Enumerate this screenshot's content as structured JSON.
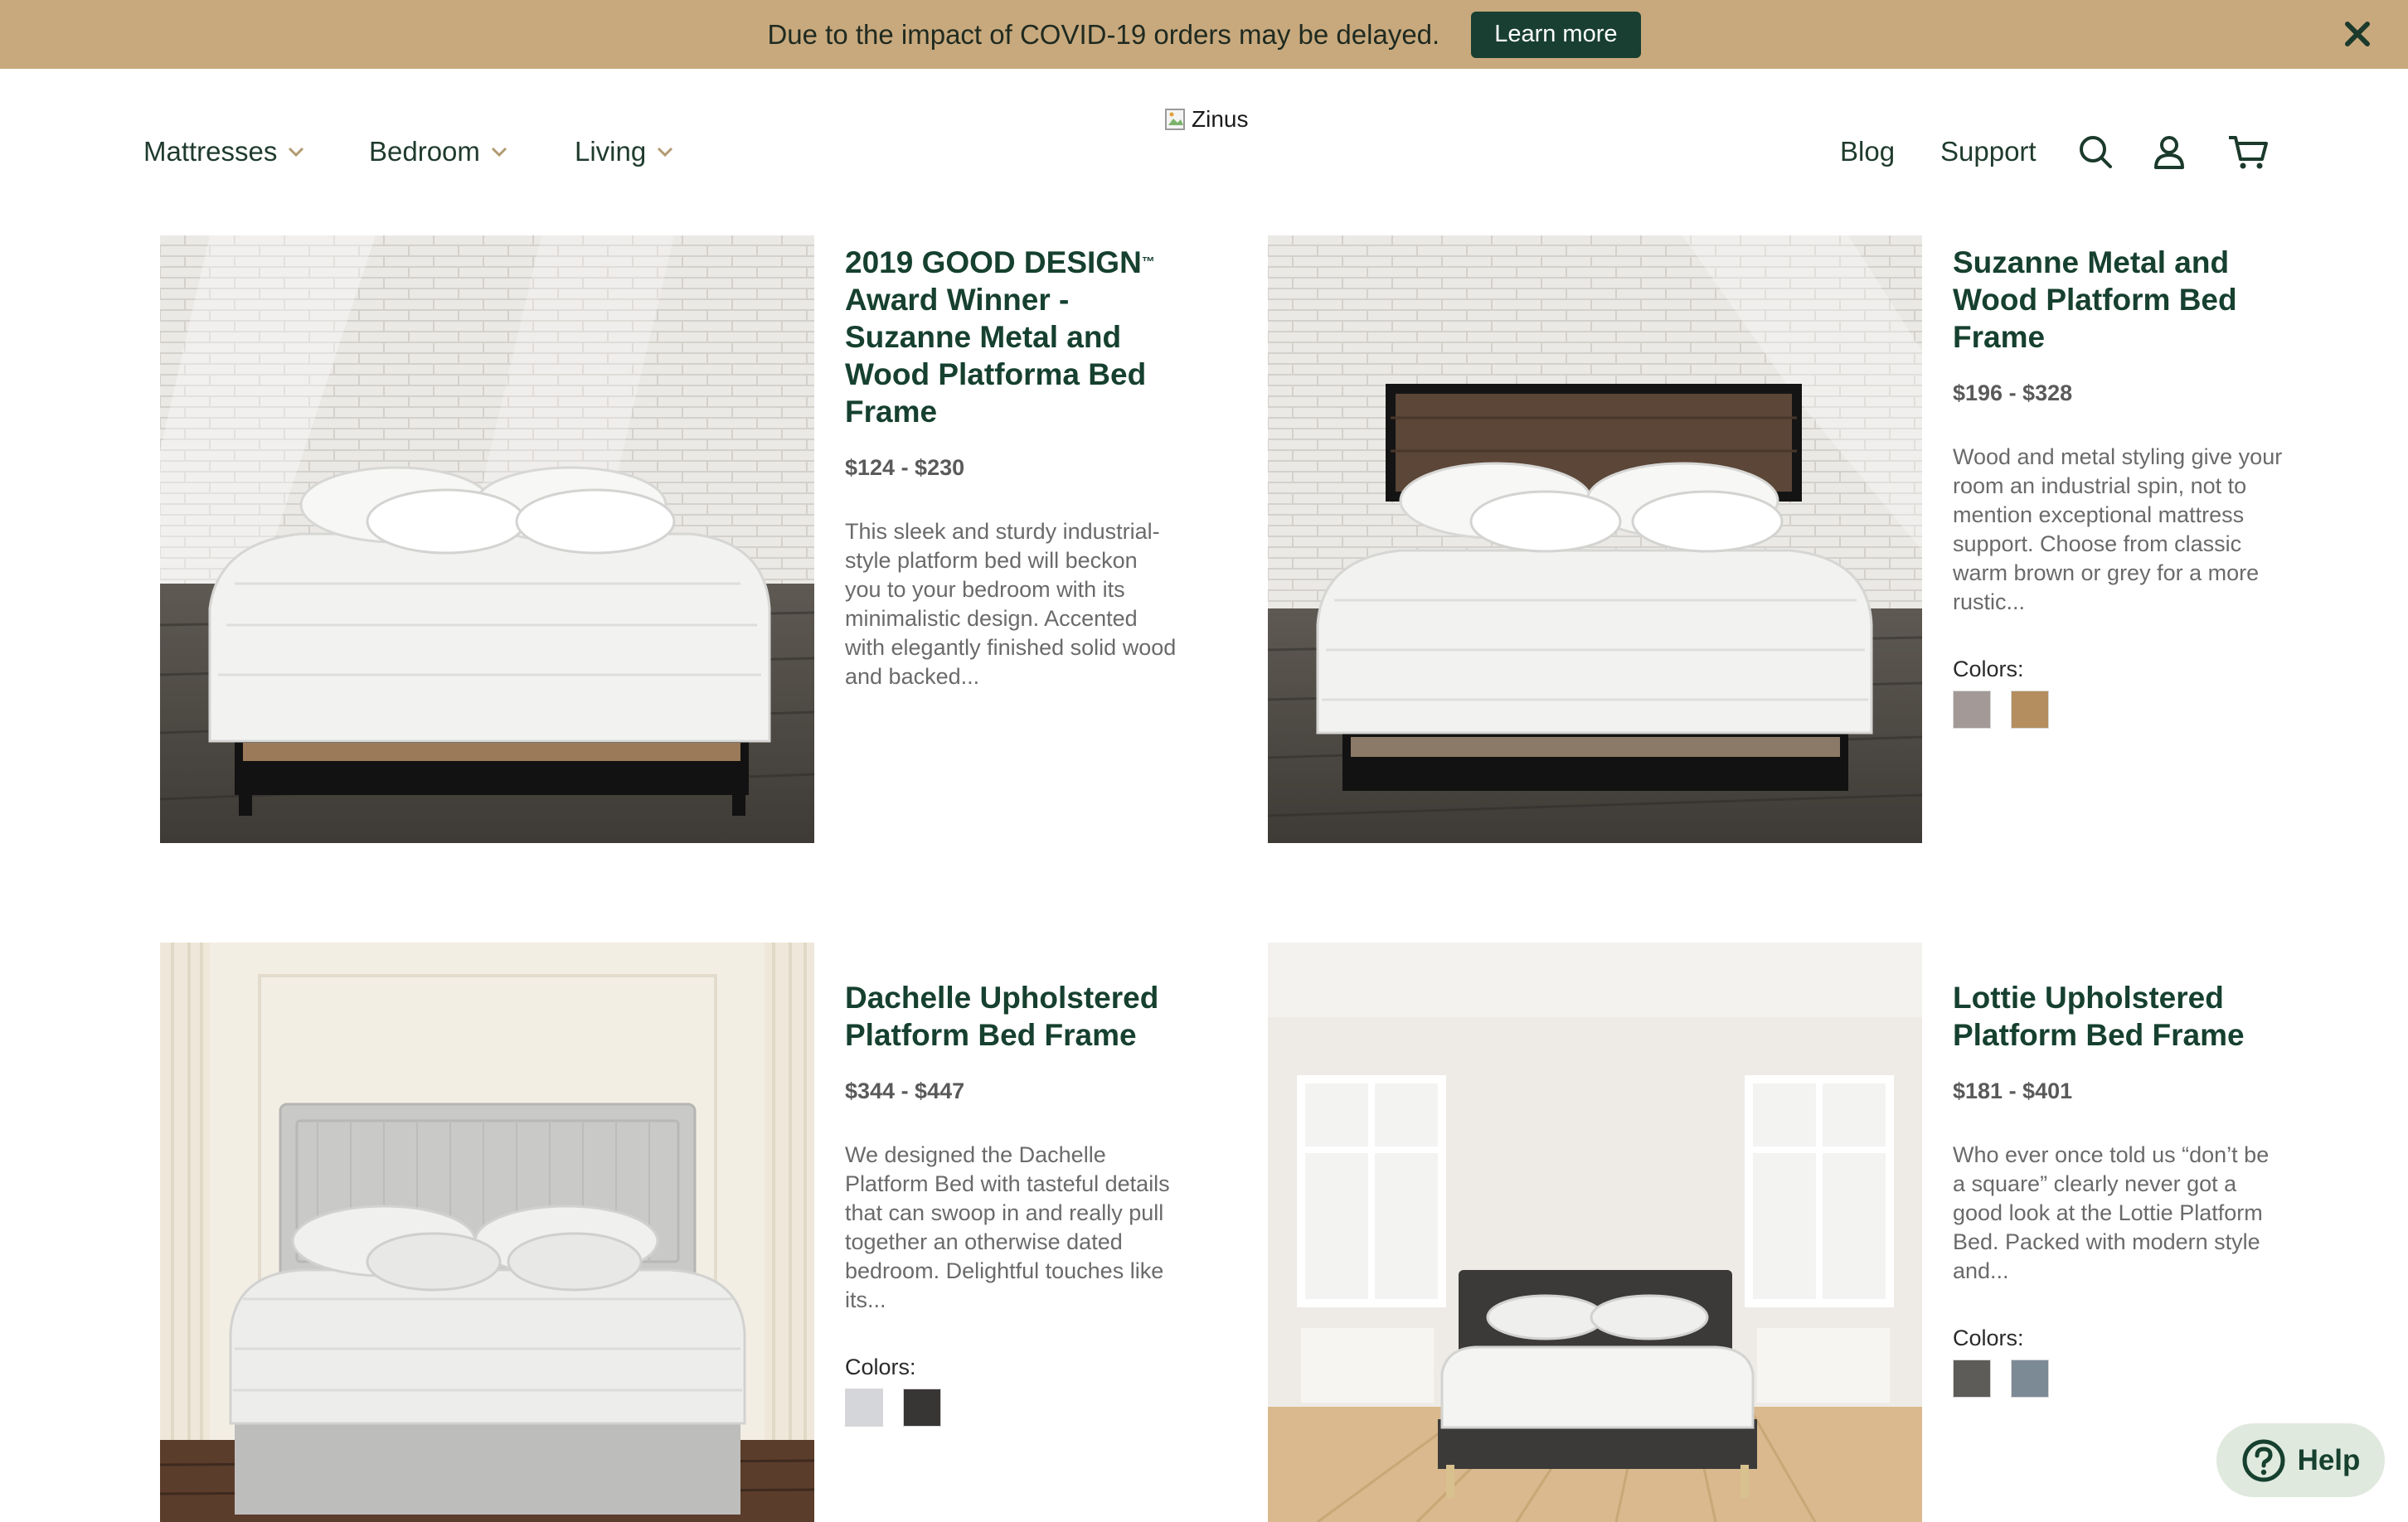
{
  "banner": {
    "message": "Due to the impact of COVID-19 orders may be delayed.",
    "button_label": "Learn more",
    "close_icon": "close-icon"
  },
  "nav": {
    "items": [
      {
        "label": "Mattresses",
        "icon": "chevron-down-icon"
      },
      {
        "label": "Bedroom",
        "icon": "chevron-down-icon"
      },
      {
        "label": "Living",
        "icon": "chevron-down-icon"
      }
    ],
    "logo_alt": "Zinus",
    "links": [
      {
        "label": "Blog"
      },
      {
        "label": "Support"
      }
    ],
    "icons": [
      "search-icon",
      "account-icon",
      "cart-icon"
    ]
  },
  "colors": {
    "banner": "#c8a97d",
    "brand_green": "#183f31",
    "help_bg": "#dfe9dd"
  },
  "products": [
    {
      "title": "2019 GOOD DESIGN",
      "title_mark": "™",
      "title_rest": "Award Winner - Suzanne Metal and Wood Platforma Bed Frame",
      "price": "$124 - $230",
      "description": "This sleek and sturdy industrial-style platform bed will beckon you to your bedroom with its minimalistic design. Accented with elegantly finished solid wood and backed..."
    },
    {
      "title": "Suzanne Metal and Wood Platform Bed Frame",
      "price": "$196 - $328",
      "description": "Wood and metal styling give your room an industrial spin, not to mention exceptional mattress support. Choose from classic warm brown or grey for a more rustic...",
      "colors_label": "Colors:",
      "swatches": [
        "#a39a98",
        "#b48e5f"
      ]
    },
    {
      "title": "Dachelle Upholstered Platform Bed Frame",
      "price": "$344 - $447",
      "description": "We designed the Dachelle Platform Bed with tasteful details that can swoop in and really pull together an otherwise dated bedroom. Delightful touches like its...",
      "colors_label": "Colors:",
      "swatches": [
        "#d4d6d9",
        "#383535"
      ]
    },
    {
      "title": "Lottie Upholstered Platform Bed Frame",
      "price": "$181 - $401",
      "description": "Who ever once told us “don’t be a square” clearly never got a good look at the Lottie Platform Bed. Packed with modern style and...",
      "colors_label": "Colors:",
      "swatches": [
        "#5e5c58",
        "#7c8a96"
      ]
    }
  ],
  "help": {
    "label": "Help",
    "icon": "help-icon"
  }
}
